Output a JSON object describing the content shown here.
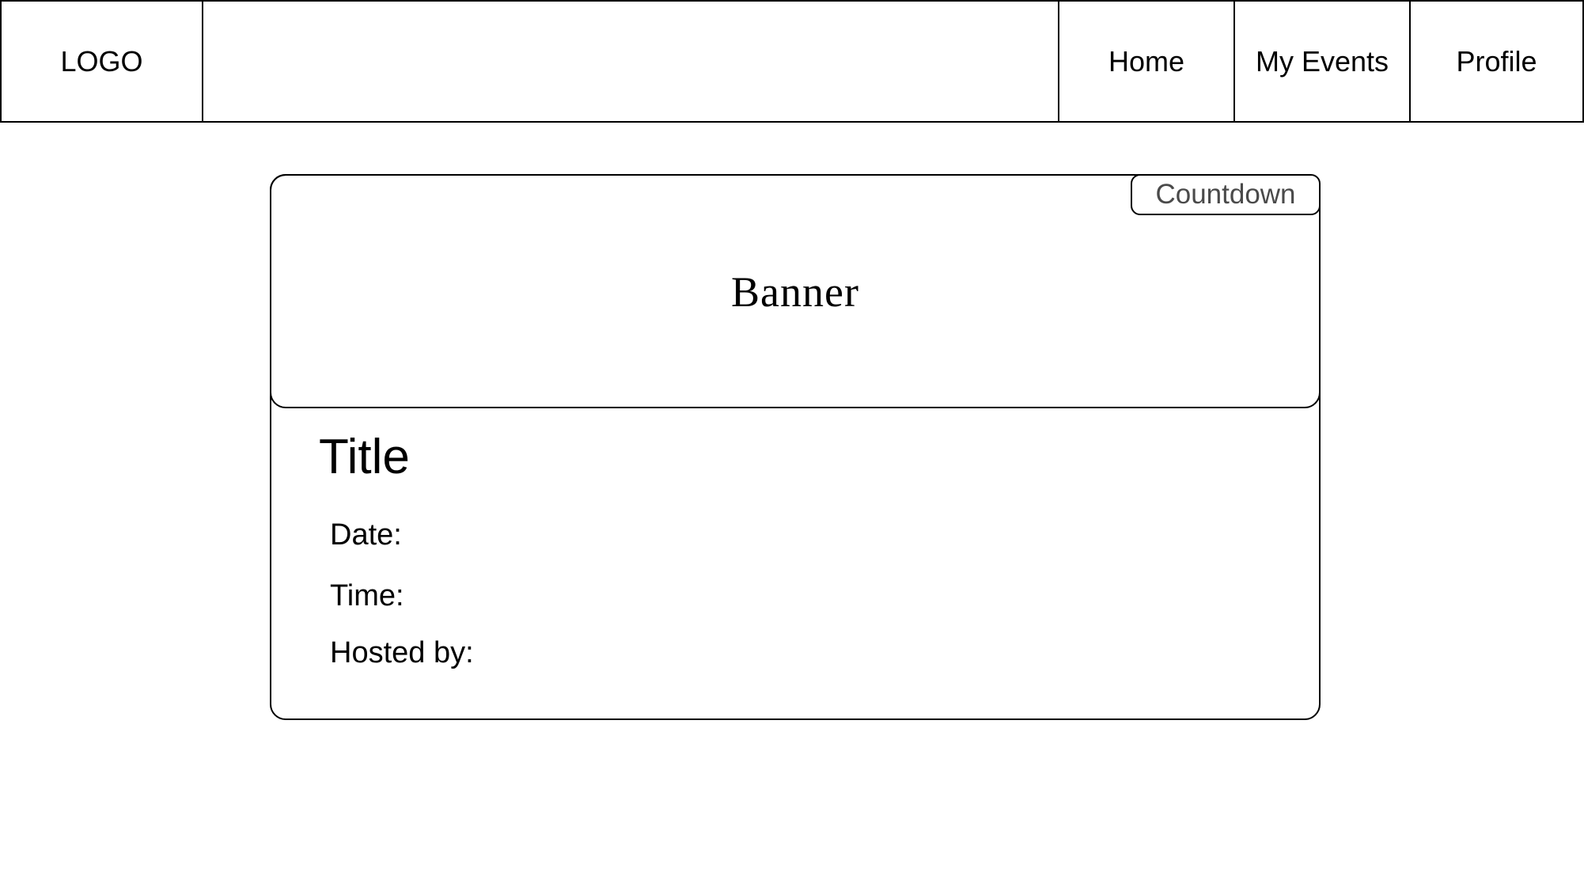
{
  "header": {
    "logo": "LOGO",
    "nav": {
      "home": "Home",
      "my_events": "My Events",
      "profile": "Profile"
    }
  },
  "event": {
    "banner": "Banner",
    "countdown": "Countdown",
    "title": "Title",
    "date_label": "Date:",
    "time_label": "Time:",
    "hosted_by_label": "Hosted by:"
  }
}
